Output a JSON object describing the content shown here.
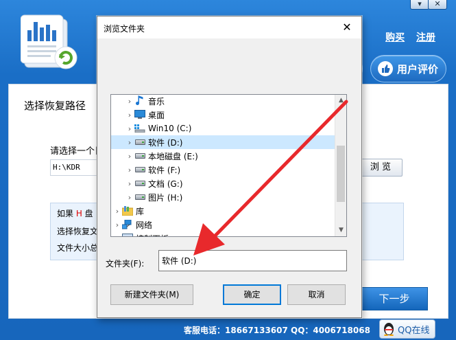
{
  "app": {
    "window_controls": [
      "▾",
      "✕"
    ],
    "top_links": {
      "buy": "购买",
      "register": "注册"
    },
    "review_button": "用户评价",
    "panel_title": "选择恢复路径",
    "path_prompt": "请选择一个目",
    "path_value": "H:\\KDR",
    "browse_button": "浏 览",
    "info_lines": [
      {
        "prefix": "如果 ",
        "drive": "H",
        "suffix": " 盘"
      },
      {
        "text": "选择恢复文"
      },
      {
        "text": "文件大小总"
      }
    ],
    "next_button": "下一步",
    "footer_text": "客服电话：18667133607 QQ：4006718068",
    "qq_button": "QQ在线"
  },
  "dialog": {
    "title": "浏览文件夹",
    "close_glyph": "✕",
    "tree_items": [
      {
        "label": "音乐",
        "icon": "music-note-icon",
        "indent": 1
      },
      {
        "label": "桌面",
        "icon": "desktop-icon",
        "indent": 1
      },
      {
        "label": "Win10 (C:)",
        "icon": "windows-drive-icon",
        "indent": 1
      },
      {
        "label": "软件 (D:)",
        "icon": "drive-icon",
        "indent": 1,
        "selected": true
      },
      {
        "label": "本地磁盘 (E:)",
        "icon": "drive-icon",
        "indent": 1
      },
      {
        "label": "软件 (F:)",
        "icon": "drive-icon",
        "indent": 1
      },
      {
        "label": "文档 (G:)",
        "icon": "drive-icon",
        "indent": 1
      },
      {
        "label": "图片 (H:)",
        "icon": "drive-icon",
        "indent": 1
      },
      {
        "label": "库",
        "icon": "library-icon",
        "indent": 0
      },
      {
        "label": "网络",
        "icon": "network-icon",
        "indent": 0
      },
      {
        "label": "控制面板",
        "icon": "control-panel-icon",
        "indent": 0
      }
    ],
    "folder_label": "文件夹(F):",
    "folder_value": "软件 (D:)",
    "buttons": {
      "new_folder": "新建文件夹(M)",
      "ok": "确定",
      "cancel": "取消"
    }
  },
  "colors": {
    "accent": "#1a6ec6",
    "selection": "#cce8ff",
    "arrow": "#e8292c"
  }
}
